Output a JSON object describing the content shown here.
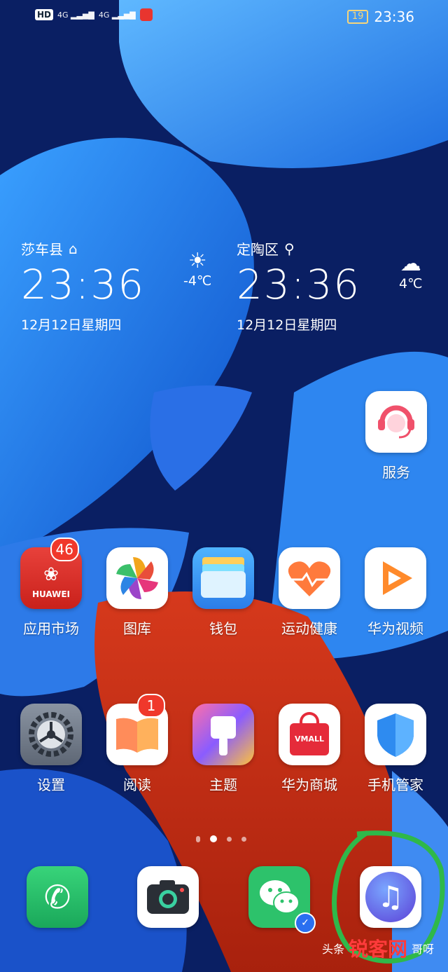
{
  "status_bar": {
    "network_1": "4G",
    "network_2": "4G",
    "battery": "19",
    "time": "23:36",
    "hd": "HD"
  },
  "clock_widget": [
    {
      "city": "莎车县",
      "time": "23:36",
      "date": "12月12日星期四",
      "temp": "-4℃"
    },
    {
      "city": "定陶区",
      "time": "23:36",
      "date": "12月12日星期四",
      "temp": "4℃"
    }
  ],
  "apps": {
    "service": "服务",
    "app_market": "应用市场",
    "app_market_badge": "46",
    "app_market_brand": "HUAWEI",
    "gallery": "图库",
    "wallet": "钱包",
    "health": "运动健康",
    "video": "华为视频",
    "settings": "设置",
    "reader": "阅读",
    "reader_badge": "1",
    "themes": "主题",
    "vmall": "华为商城",
    "vmall_brand": "VMALL",
    "phone_manager": "手机管家"
  },
  "watermark": {
    "prefix": "头条",
    "brand": "锐客网",
    "suffix": "哥呀"
  }
}
